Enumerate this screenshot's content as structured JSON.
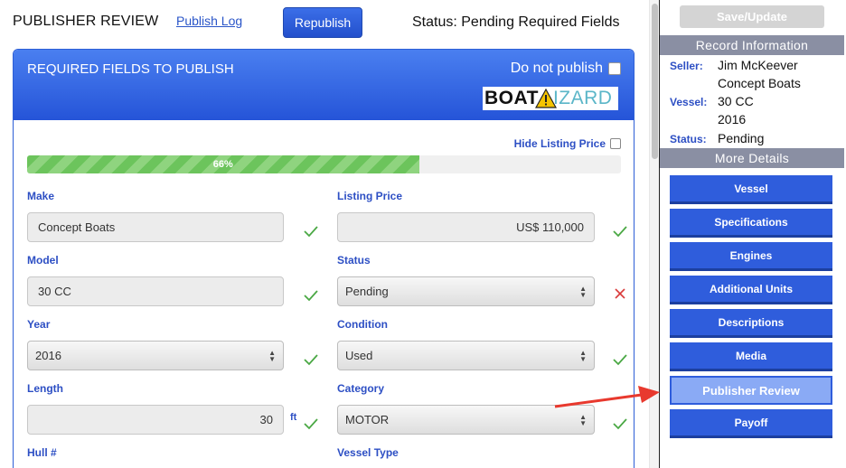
{
  "header": {
    "title": "PUBLISHER REVIEW",
    "publish_log": "Publish Log",
    "republish": "Republish",
    "status": "Status: Pending Required Fields"
  },
  "panel": {
    "title": "REQUIRED FIELDS TO PUBLISH",
    "do_not_publish": "Do not publish",
    "logo_left": "BOAT",
    "logo_right": "IZARD",
    "hide_listing_price": "Hide Listing Price",
    "progress_label": "66%",
    "progress_value": 0.66
  },
  "fields": {
    "make": {
      "label": "Make",
      "value": "Concept Boats",
      "status": "valid"
    },
    "listing_price": {
      "label": "Listing Price",
      "value": "US$ 110,000",
      "status": "valid"
    },
    "model": {
      "label": "Model",
      "value": "30 CC",
      "status": "valid"
    },
    "status": {
      "label": "Status",
      "value": "Pending",
      "status": "invalid"
    },
    "year": {
      "label": "Year",
      "value": "2016",
      "status": "valid"
    },
    "condition": {
      "label": "Condition",
      "value": "Used",
      "status": "valid"
    },
    "length": {
      "label": "Length",
      "value": "30",
      "unit": "ft",
      "status": "valid"
    },
    "category": {
      "label": "Category",
      "value": "MOTOR",
      "status": "valid"
    },
    "hull": {
      "label": "Hull #"
    },
    "vessel_type": {
      "label": "Vessel Type"
    }
  },
  "sidebar": {
    "save_update": "Save/Update",
    "record_info_title": "Record Information",
    "seller_key": "Seller:",
    "seller_name": "Jim McKeever",
    "seller_company": "Concept Boats",
    "vessel_key": "Vessel:",
    "vessel_model": "30 CC",
    "vessel_year": "2016",
    "status_key": "Status:",
    "status_value": "Pending",
    "more_details_title": "More Details",
    "nav": [
      {
        "label": "Vessel"
      },
      {
        "label": "Specifications"
      },
      {
        "label": "Engines"
      },
      {
        "label": "Additional Units"
      },
      {
        "label": "Descriptions"
      },
      {
        "label": "Media"
      },
      {
        "label": "Publisher Review",
        "active": true
      },
      {
        "label": "Payoff"
      }
    ]
  },
  "colors": {
    "accent": "#2f5ddc",
    "valid_check": "#4aa844",
    "invalid_x": "#d93a3a",
    "annotation_arrow": "#e8392e"
  }
}
